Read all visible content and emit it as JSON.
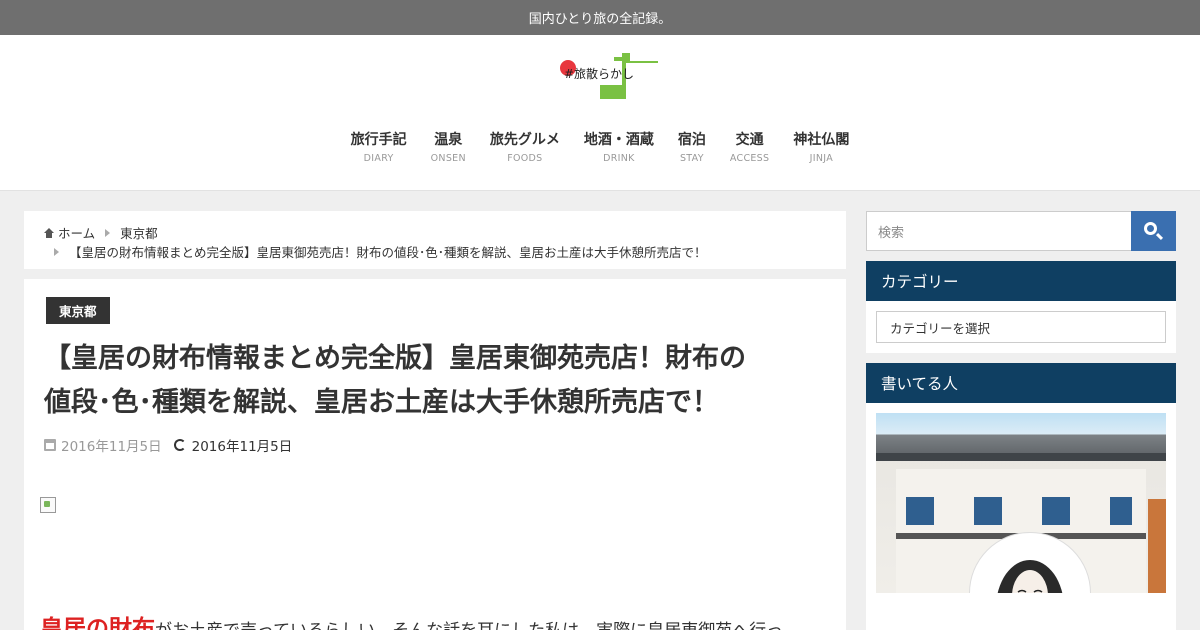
{
  "topbar": {
    "tagline": "国内ひとり旅の全記録。"
  },
  "header": {
    "logo_text": "#旅散らかし",
    "nav": [
      {
        "jp": "旅行手記",
        "en": "DIARY"
      },
      {
        "jp": "温泉",
        "en": "ONSEN"
      },
      {
        "jp": "旅先グルメ",
        "en": "FOODS"
      },
      {
        "jp": "地酒・酒蔵",
        "en": "DRINK"
      },
      {
        "jp": "宿泊",
        "en": "STAY"
      },
      {
        "jp": "交通",
        "en": "ACCESS"
      },
      {
        "jp": "神社仏閣",
        "en": "JINJA"
      }
    ]
  },
  "breadcrumb": {
    "home": "ホーム",
    "category": "東京都",
    "current": "【皇居の財布情報まとめ完全版】皇居東御苑売店！財布の値段･色･種類を解説、皇居お土産は大手休憩所売店で！"
  },
  "article": {
    "category_badge": "東京都",
    "title_line1": "【皇居の財布情報まとめ完全版】皇居東御苑売店！財布の",
    "title_line2": "値段･色･種類を解説、皇居お土産は大手休憩所売店で！",
    "date_published": "2016年11月5日",
    "date_updated": "2016年11月5日",
    "intro_highlight": "皇居の財布",
    "intro_text": "がお土産で売っているらしい。そんな話を耳にした私は、実際に皇居東御苑へ行っ"
  },
  "sidebar": {
    "search_placeholder": "検索",
    "categories_title": "カテゴリー",
    "categories_select": "カテゴリーを選択",
    "profile_title": "書いてる人"
  },
  "colors": {
    "topbar": "#6f6f6f",
    "widget_title": "#0f3f62",
    "search_button": "#3a6fb0",
    "highlight": "#dd2222",
    "logo_green": "#7ac143",
    "logo_red": "#e8373e"
  }
}
